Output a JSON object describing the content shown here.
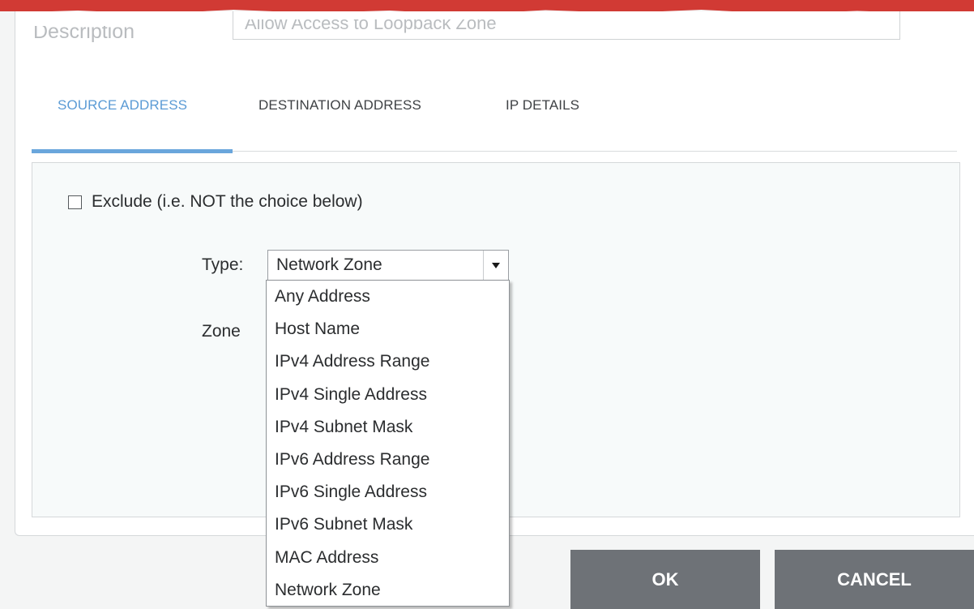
{
  "dialog": {
    "description_label": "Description",
    "description_value": "Allow Access to Loopback Zone"
  },
  "tabs": [
    {
      "label": "SOURCE ADDRESS",
      "active": true
    },
    {
      "label": "DESTINATION ADDRESS",
      "active": false
    },
    {
      "label": "IP DETAILS",
      "active": false
    }
  ],
  "source": {
    "exclude_label": "Exclude (i.e. NOT the choice below)",
    "exclude_checked": false,
    "type_label": "Type:",
    "type_value": "Network Zone",
    "zone_label": "Zone"
  },
  "dropdown": {
    "items": [
      "Any Address",
      "Host Name",
      "IPv4 Address Range",
      "IPv4 Single Address",
      "IPv4 Subnet Mask",
      "IPv6 Address Range",
      "IPv6 Single Address",
      "IPv6 Subnet Mask",
      "MAC Address",
      "Network Zone"
    ]
  },
  "buttons": {
    "ok": "OK",
    "cancel": "CANCEL"
  },
  "colors": {
    "accent": "#5b9bd5",
    "button": "#6e7277",
    "header_red": "#d13a34"
  }
}
